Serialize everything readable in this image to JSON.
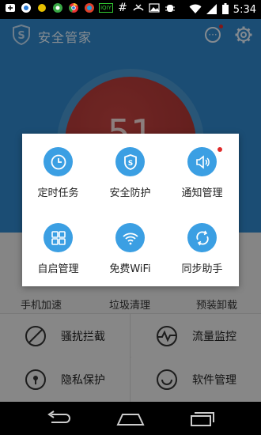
{
  "status_bar": {
    "time": "5:34",
    "left_icons": [
      "usb-icon",
      "browser-icon",
      "circle-icon",
      "app-icon",
      "chrome-icon",
      "contacts-icon",
      "iqiyi-icon",
      "hash-icon",
      "missed-call-icon",
      "image-icon",
      "debug-icon"
    ],
    "iqiyi_label": "iQIY",
    "hash_label": "#"
  },
  "header": {
    "title": "安全管家",
    "brand_letter": "S",
    "more_label": "···"
  },
  "score": {
    "value": "51"
  },
  "quick_actions": [
    {
      "label": "手机加速"
    },
    {
      "label": "垃圾清理"
    },
    {
      "label": "预装卸载"
    }
  ],
  "tools": [
    {
      "label": "骚扰拦截",
      "icon": "block-icon"
    },
    {
      "label": "流量监控",
      "icon": "pulse-icon"
    },
    {
      "label": "隐私保护",
      "icon": "lock-icon"
    },
    {
      "label": "软件管理",
      "icon": "smile-icon"
    }
  ],
  "menu": {
    "items": [
      {
        "label": "定时任务",
        "icon": "clock-icon"
      },
      {
        "label": "安全防护",
        "icon": "shield-icon"
      },
      {
        "label": "通知管理",
        "icon": "speaker-icon",
        "badge": true
      },
      {
        "label": "自启管理",
        "icon": "grid-icon"
      },
      {
        "label": "免费WiFi",
        "icon": "wifi-icon"
      },
      {
        "label": "同步助手",
        "icon": "sync-icon"
      }
    ]
  },
  "colors": {
    "header_blue": "#2f86c8",
    "ball_red": "#ad3634",
    "menu_icon_blue": "#3b9fe3",
    "badge_red": "#e02a2a"
  }
}
